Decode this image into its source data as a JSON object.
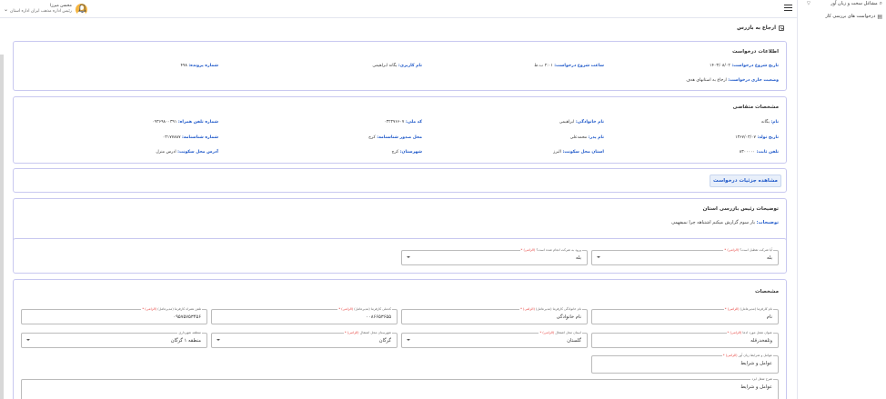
{
  "header": {
    "user_name": "محسن میرزا",
    "user_role": "رئیس اداره مذهب ایران اداره استان",
    "bell_icon": "bell-icon",
    "menu_icon": "hamburger-icon"
  },
  "sidebar": {
    "items": [
      {
        "label": "مشاغل سخت و زیان آور",
        "icon": "search-icon"
      },
      {
        "label": "درخواست های بررسی کار",
        "icon": "document-icon"
      }
    ]
  },
  "page": {
    "title": "ارجاع به بازرس"
  },
  "request_info": {
    "title": "اطلاعات درخواست",
    "fields": [
      {
        "label": "تاریخ شروع درخواست:",
        "value": "۱۴۰۳/۰۸/۰۲"
      },
      {
        "label": "ساعت شروع درخواست:",
        "value": "۲:۰۱ ب.ظ"
      },
      {
        "label": "نام کاربری:",
        "value": "یگانه ابراهیمی"
      },
      {
        "label": "شماره پرونده:",
        "value": "۴۹۸"
      },
      {
        "label": "وضعیت جاری درخواست:",
        "value": "ارجاع به استانهای هدف"
      }
    ]
  },
  "applicant": {
    "title": "مشخصات متقاضی",
    "fields": [
      {
        "label": "نام:",
        "value": "یگانه"
      },
      {
        "label": "نام خانوادگی:",
        "value": "ابراهیمی"
      },
      {
        "label": "کد ملی:",
        "value": "۰۳۲۲۷۶۶۰۷"
      },
      {
        "label": "شماره تلفن همراه:",
        "value": "۰۹۳۶۹۸۰۰۳۹۱"
      },
      {
        "label": "تاریخ تولد:",
        "value": "۱۳۶۷/۰۳/۰۷"
      },
      {
        "label": "نام پدر:",
        "value": "محمدعلی"
      },
      {
        "label": "محل صدور شناسنامه:",
        "value": "کرج"
      },
      {
        "label": "شماره شناسنامه:",
        "value": "۰۳۱۷۷۸۸۷"
      },
      {
        "label": "تلفن ثابت:",
        "value": "۸۳۰۰۰۰۰"
      },
      {
        "label": "استان محل سکونت:",
        "value": "البرز"
      },
      {
        "label": "شهرستان:",
        "value": "کرج"
      },
      {
        "label": "آدرس محل سکونت:",
        "value": "ادرس منزل"
      }
    ]
  },
  "detail_button": {
    "label": "مشاهده جزئیات درخواست"
  },
  "provincial_notes": {
    "title": "توضیحات رئیس بازرسی استان",
    "label": "توضیحات:",
    "value": "بار سوم گزارش میکنم اشتباهه چرا نمیفهمی"
  },
  "company_select": {
    "q1": {
      "legend": "آیا شرکت تعطیل است؟",
      "required": "(الزامی) *",
      "value": "بله"
    },
    "q2": {
      "legend": "ورود به شرکت انجام شده است؟",
      "required": "(الزامی) *",
      "value": "بله"
    }
  },
  "specs": {
    "title": "مشخصات",
    "inputs": [
      {
        "legend": "نام کارفرما (مدیرعامل)",
        "required": "(الزامی) *",
        "value": "نام"
      },
      {
        "legend": "نام خانوادگی کارفرما (مدیرعامل)",
        "required": "(الزامی) *",
        "value": "نام خانوادگی"
      },
      {
        "legend": "کدملی کارفرما (مدیرعامل)",
        "required": "(الزامی) *",
        "value": "۰۰۸۶۶۵۳۶۵۵"
      },
      {
        "legend": "تلفن همراه کارفرما (مدیرعامل)",
        "required": "(الزامی) *",
        "value": "۰۹۵۷۵۷۵۳۴۵۶"
      },
      {
        "legend": "عنوان شغل مورد ادعا",
        "required": "(الزامی) *",
        "value": "وتلفخدرقله"
      },
      {
        "legend": "استان محل اشتغال",
        "required": "(الزامی) *",
        "value": "گلستان"
      },
      {
        "legend": "شهرستان محل اشتغال",
        "required": "(الزامی) *",
        "value": "گرگان"
      },
      {
        "legend": "منطقه شهرداری",
        "required": "",
        "value": "منطقه ۱ گرگان"
      },
      {
        "legend": "عوامل و شرایط زیان آور",
        "required": "(الزامی) *",
        "value": "عوامل و شرایط"
      },
      {
        "legend": "شرح شغل ابزد",
        "required": "",
        "value": "عوامل و شرایط"
      }
    ]
  }
}
